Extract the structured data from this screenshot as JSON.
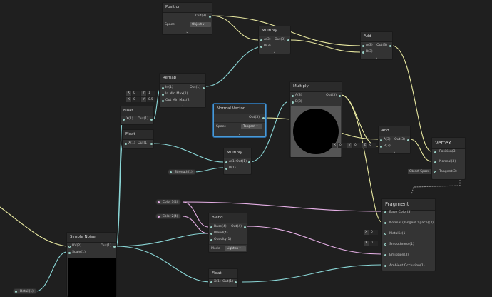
{
  "colors": {
    "background": "#1f1f1f",
    "node": "#333333",
    "wire_vec": "#e8e8a0",
    "wire_float": "#8ad6d6",
    "wire_color": "#e6b0e6",
    "selected": "#4a9ad6"
  },
  "position_node": {
    "title": "Position",
    "out": "Out(3)",
    "space_label": "Space",
    "space_value": "Object"
  },
  "multiply_top": {
    "title": "Multiply",
    "in_a": "A(3)",
    "in_b": "B(3)",
    "out": "Out(3)"
  },
  "add_top": {
    "title": "Add",
    "in_a": "A(3)",
    "in_b": "B(3)",
    "out": "Out(3)"
  },
  "remap": {
    "title": "Remap",
    "in": "In(1)",
    "in_min_max": "In Min Max(2)",
    "out_min_max": "Out Min Max(2)",
    "out": "Out(1)",
    "row1": {
      "x_label": "X",
      "x_val": "0",
      "y_label": "Y",
      "y_val": "1"
    },
    "row2": {
      "x_label": "X",
      "x_val": "0",
      "y_label": "Y",
      "y_val": "0.5"
    }
  },
  "float_top": {
    "title": "Float",
    "x": "X(1)",
    "out": "Out(1)"
  },
  "float_mid": {
    "title": "Float",
    "x": "X(1)",
    "out": "Out(1)"
  },
  "normal_vector": {
    "title": "Normal Vector",
    "out": "Out(3)",
    "space_label": "Space",
    "space_value": "Tangent"
  },
  "multiply_mid": {
    "title": "Multiply",
    "in_a": "A(3)",
    "in_b": "B(3)",
    "out": "Out(3)"
  },
  "multiply_small": {
    "title": "Multiply",
    "in_a": "A(1)",
    "in_b": "B(1)",
    "out": "Out(1)"
  },
  "add_mid": {
    "title": "Add",
    "in_a": "A(3)",
    "in_b": "B(3)",
    "out": "Out(3)",
    "b_default": {
      "x_label": "X",
      "x_val": "0",
      "y_label": "Y",
      "y_val": "0",
      "z_label": "Z",
      "z_val": "0"
    }
  },
  "strength_prop": {
    "label": "Strength(1)"
  },
  "vertex": {
    "title": "Vertex",
    "position": "Position(3)",
    "normal": "Normal(3)",
    "tangent": "Tangent(3)",
    "tangent_space": "Object Space"
  },
  "fragment": {
    "title": "Fragment",
    "base_color": "Base Color(3)",
    "normal_ts": "Normal (Tangent Space)(3)",
    "metallic": "Metallic(1)",
    "smoothness": "Smoothness(1)",
    "emission": "Emission(3)",
    "ao": "Ambient Occlusion(1)",
    "metallic_default": {
      "x_label": "X",
      "x_val": "0"
    },
    "smoothness_default": {
      "x_label": "X",
      "x_val": "0"
    }
  },
  "color1_prop": {
    "label": "Color 1(4)"
  },
  "color2_prop": {
    "label": "Color 2(4)"
  },
  "blend": {
    "title": "Blend",
    "base": "Base(4)",
    "blend": "Blend(4)",
    "opacity": "Opacity(1)",
    "out": "Out(4)",
    "mode_label": "Mode",
    "mode_value": "Lighten"
  },
  "simple_noise": {
    "title": "Simple Noise",
    "uv": "UV(2)",
    "scale": "Scale(1)",
    "out": "Out(1)"
  },
  "float_bottom": {
    "title": "Float",
    "x": "X(1)",
    "out": "Out(1)"
  },
  "detail_prop": {
    "label": "Detail(1)"
  }
}
